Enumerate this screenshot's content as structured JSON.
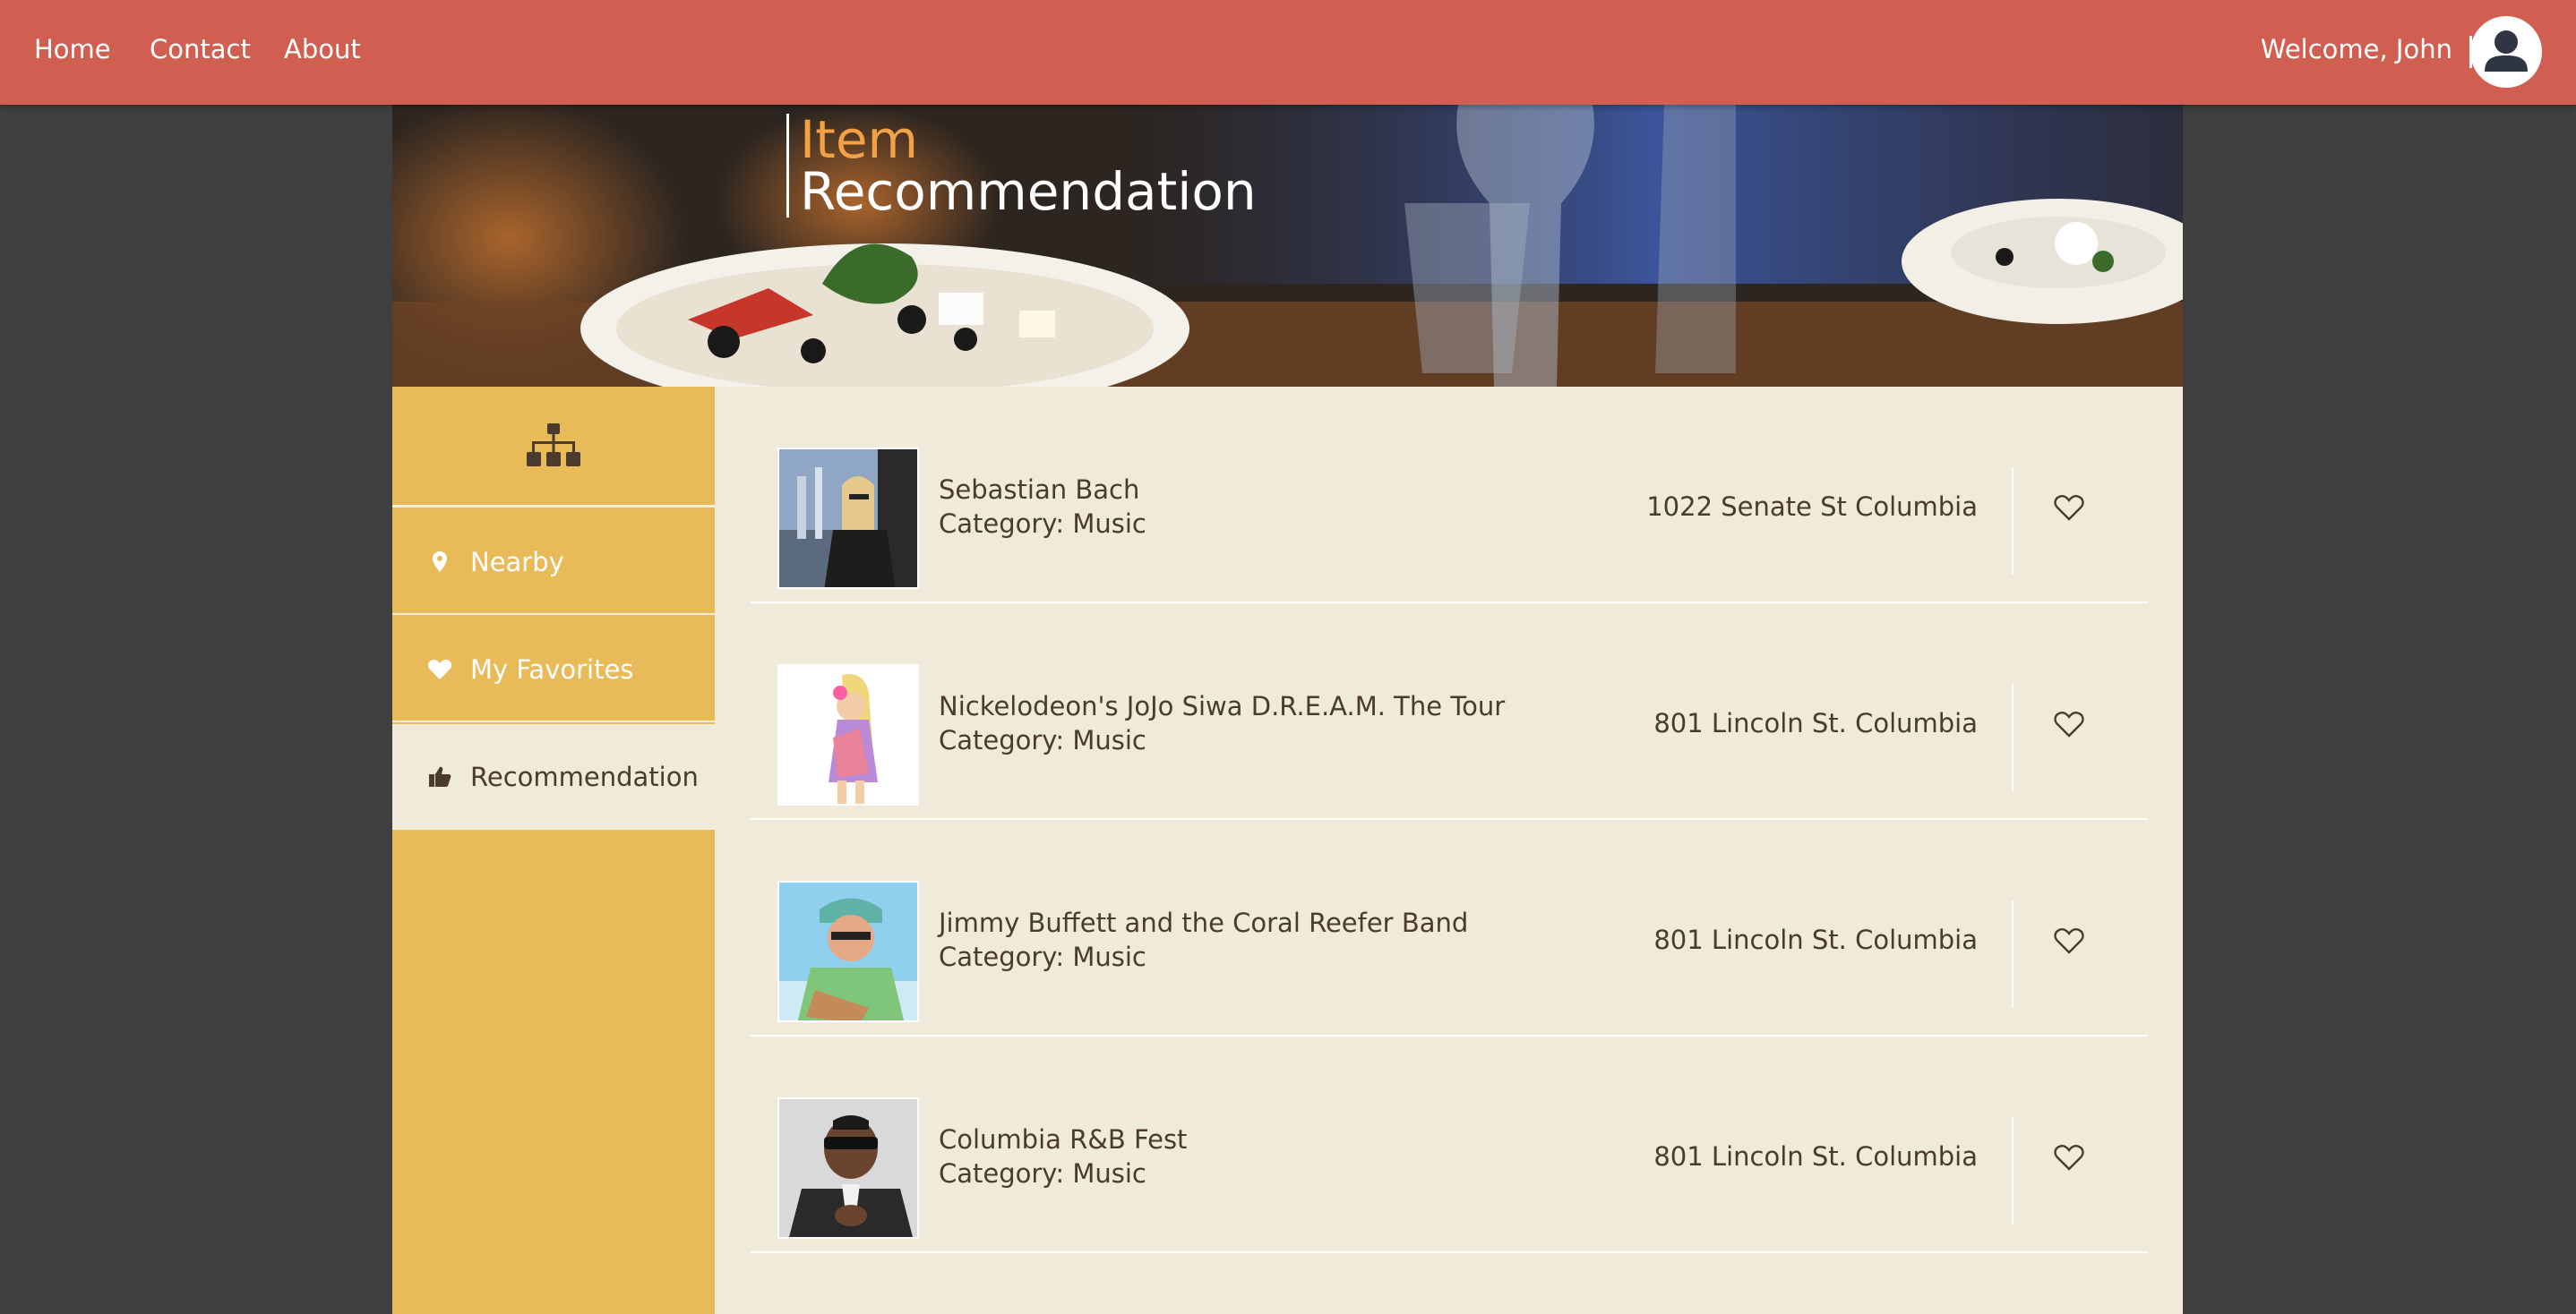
{
  "nav": {
    "links": [
      "Home",
      "Contact",
      "About"
    ],
    "welcome": "Welcome, John"
  },
  "hero": {
    "title_line1": "Item",
    "title_line2": "Recommendation"
  },
  "sidebar": {
    "top_icon": "sitemap-icon",
    "items": [
      {
        "label": "Nearby",
        "icon": "map-marker-icon",
        "active": false
      },
      {
        "label": "My Favorites",
        "icon": "heart-icon",
        "active": false
      },
      {
        "label": "Recommendation",
        "icon": "thumbs-up-icon",
        "active": true
      }
    ]
  },
  "items": [
    {
      "name": "Sebastian Bach",
      "category": "Category: Music",
      "address": "1022 Senate St Columbia"
    },
    {
      "name": "Nickelodeon's JoJo Siwa D.R.E.A.M. The Tour",
      "category": "Category: Music",
      "address": "801 Lincoln St. Columbia"
    },
    {
      "name": "Jimmy Buffett and the Coral Reefer Band",
      "category": "Category: Music",
      "address": "801 Lincoln St. Columbia"
    },
    {
      "name": "Columbia R&B Fest",
      "category": "Category: Music",
      "address": "801 Lincoln St. Columbia"
    }
  ],
  "colors": {
    "nav_bg": "#d15f51",
    "sidebar_bg": "#e9ba58",
    "content_bg": "#f0eadb",
    "hero_accent": "#f2a244",
    "text_dark": "#4b3b2e",
    "page_bg": "#3f3f3f"
  }
}
